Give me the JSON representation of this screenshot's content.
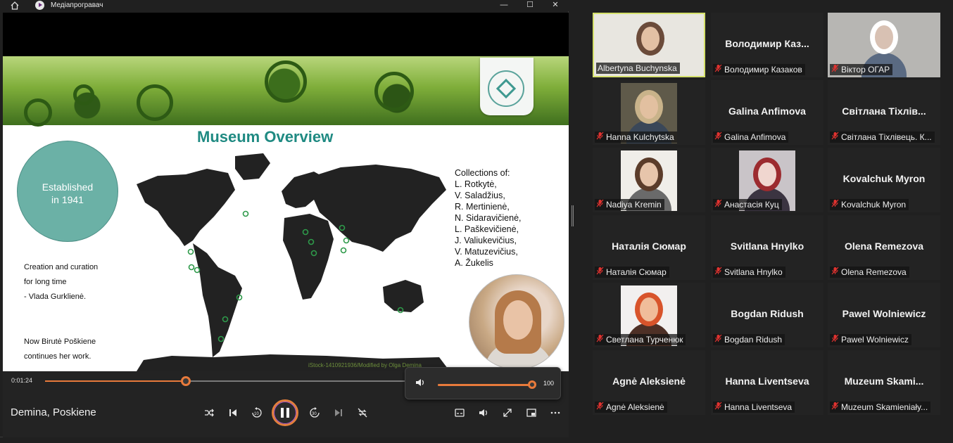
{
  "app": {
    "title": "Медіапрогравач",
    "window_buttons": [
      "—",
      "☐",
      "✕"
    ]
  },
  "slide": {
    "title": "Museum Overview",
    "established": [
      "Established",
      "in 1941"
    ],
    "creation": [
      "Creation and curation",
      "for long time",
      "- Vlada Gurklienė."
    ],
    "now": [
      "Now Birutė Poškiene",
      "continues her work."
    ],
    "collections": [
      "Collections of:",
      " L. Rotkytė,",
      "V. Saladžius,",
      "R. Mertinienė,",
      "N. Sidaravičienė,",
      "L. Paškevičienė,",
      "J. Valiukevičius,",
      "V. Matuzevičius,",
      "A. Žukelis"
    ],
    "credit": "iStock-1410921936/Modified by Olga Demina"
  },
  "player": {
    "current_time": "0:01:24",
    "progress": 0.29,
    "media_title": "Demina, Poskiene",
    "volume": 100,
    "volume_label": "100",
    "accent": "#e87a3b"
  },
  "participants": [
    {
      "name": "Albertyna Buchynska",
      "display": "",
      "video": true,
      "speaking": true
    },
    {
      "name": "Володимир Казаков",
      "display": "Володимир Каз...",
      "video": false
    },
    {
      "name": "Віктор ОГАР",
      "display": "",
      "video": true
    },
    {
      "name": "Hanna Kulchytska",
      "display": "",
      "video": true
    },
    {
      "name": "Galina Anfimova",
      "display": "Galina Anfimova",
      "video": false
    },
    {
      "name": "Світлана Тіхлівець. К...",
      "display": "Світлана Тіхлів...",
      "video": false
    },
    {
      "name": "Nadiya Kremin",
      "display": "",
      "video": true
    },
    {
      "name": "Анастасія Куц",
      "display": "",
      "video": true
    },
    {
      "name": "Kovalchuk Myron",
      "display": "Kovalchuk Myron",
      "video": false
    },
    {
      "name": "Наталія Сюмар",
      "display": "Наталія Сюмар",
      "video": false
    },
    {
      "name": "Svitlana Hnylko",
      "display": "Svitlana Hnylko",
      "video": false
    },
    {
      "name": "Olena Remezova",
      "display": "Olena Remezova",
      "video": false
    },
    {
      "name": "Светлана Турченюк",
      "display": "",
      "video": true
    },
    {
      "name": "Bogdan Ridush",
      "display": "Bogdan Ridush",
      "video": false
    },
    {
      "name": "Pawel Wolniewicz",
      "display": "Pawel Wolniewicz",
      "video": false
    },
    {
      "name": "Agnė Aleksienė",
      "display": "Agnė Aleksienė",
      "video": false
    },
    {
      "name": "Hanna Liventseva",
      "display": "Hanna Liventseva",
      "video": false
    },
    {
      "name": "Muzeum Skamieniały...",
      "display": "Muzeum  Skami...",
      "video": false
    }
  ]
}
